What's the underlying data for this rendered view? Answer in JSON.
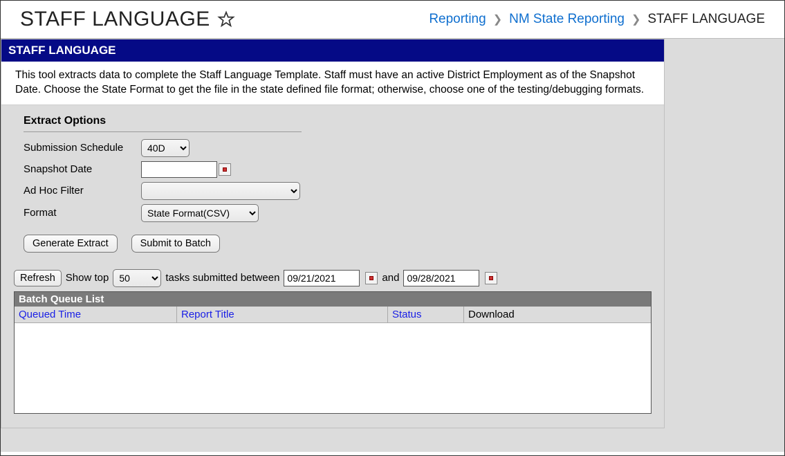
{
  "header": {
    "title": "STAFF LANGUAGE",
    "breadcrumb": {
      "link1": "Reporting",
      "link2": "NM State Reporting",
      "current": "STAFF LANGUAGE"
    }
  },
  "panel": {
    "title": "STAFF LANGUAGE",
    "description": "This tool extracts data to complete the Staff Language Template. Staff must have an active District Employment as of the Snapshot Date. Choose the State Format to get the file in the state defined file format; otherwise, choose one of the testing/debugging formats."
  },
  "options": {
    "section_title": "Extract Options",
    "submission_label": "Submission Schedule",
    "submission_value": "40D",
    "snapshot_label": "Snapshot Date",
    "snapshot_value": "",
    "adhoc_label": "Ad Hoc Filter",
    "adhoc_value": "",
    "format_label": "Format",
    "format_value": "State Format(CSV)",
    "generate_btn": "Generate Extract",
    "submit_btn": "Submit to Batch"
  },
  "filter": {
    "refresh_btn": "Refresh",
    "show_top_label": "Show top",
    "show_top_value": "50",
    "between_label": "tasks submitted between",
    "date_from": "09/21/2021",
    "and_label": "and",
    "date_to": "09/28/2021"
  },
  "queue": {
    "title": "Batch Queue List",
    "cols": {
      "c1": "Queued Time",
      "c2": "Report Title",
      "c3": "Status",
      "c4": "Download"
    }
  }
}
